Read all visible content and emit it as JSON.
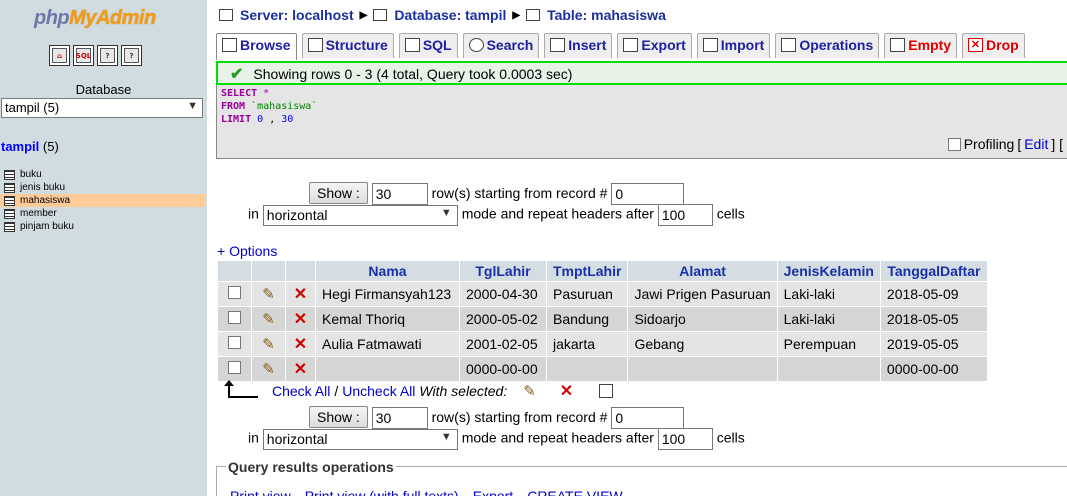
{
  "sidebar": {
    "logo_part1": "php",
    "logo_part2": "MyAdmin",
    "quick_icons": [
      "home-icon",
      "sql-query-icon",
      "docs-icon",
      "help-icon"
    ],
    "database_label": "Database",
    "database_select": "tampil (5)",
    "db_name": "tampil",
    "db_count": "(5)",
    "tables": [
      {
        "name": "buku",
        "active": false
      },
      {
        "name": "jenis buku",
        "active": false
      },
      {
        "name": "mahasiswa",
        "active": true
      },
      {
        "name": "member",
        "active": false
      },
      {
        "name": "pinjam buku",
        "active": false
      }
    ]
  },
  "breadcrumb": {
    "server": "Server: localhost",
    "database": "Database: tampil",
    "table": "Table: mahasiswa"
  },
  "tabs": [
    {
      "label": "Browse",
      "icon": "browse-icon",
      "active": true,
      "danger": false
    },
    {
      "label": "Structure",
      "icon": "structure-icon",
      "active": false,
      "danger": false
    },
    {
      "label": "SQL",
      "icon": "sql-icon",
      "active": false,
      "danger": false
    },
    {
      "label": "Search",
      "icon": "search-icon",
      "active": false,
      "danger": false
    },
    {
      "label": "Insert",
      "icon": "insert-icon",
      "active": false,
      "danger": false
    },
    {
      "label": "Export",
      "icon": "export-icon",
      "active": false,
      "danger": false
    },
    {
      "label": "Import",
      "icon": "import-icon",
      "active": false,
      "danger": false
    },
    {
      "label": "Operations",
      "icon": "operations-icon",
      "active": false,
      "danger": false
    },
    {
      "label": "Empty",
      "icon": "empty-icon",
      "active": false,
      "danger": true
    },
    {
      "label": "Drop",
      "icon": "drop-icon",
      "active": false,
      "danger": true
    }
  ],
  "message": "Showing rows 0 - 3 (4 total, Query took 0.0003 sec)",
  "sql": {
    "line1_kw": "SELECT",
    "line1_rest": "*",
    "line2_kw": "FROM",
    "line2_table": "`mahasiswa`",
    "line3_kw": "LIMIT",
    "line3_a": "0",
    "line3_sep": ",",
    "line3_b": "30"
  },
  "profiling": {
    "label": "Profiling",
    "edit": "Edit",
    "bracket_open": "[",
    "bracket_close": "] ["
  },
  "nav": {
    "show_label": "Show :",
    "rows_value": "30",
    "starting_text": "row(s) starting from record #",
    "start_value": "0",
    "in_text": "in",
    "mode_value": "horizontal",
    "mode_text": "mode and repeat headers after",
    "repeat_value": "100",
    "cells_text": "cells"
  },
  "options_link": "+ Options",
  "table": {
    "columns": [
      "Nama",
      "TglLahir",
      "TmptLahir",
      "Alamat",
      "JenisKelamin",
      "TanggalDaftar"
    ],
    "rows": [
      [
        "Hegi Firmansyah123",
        "2000-04-30",
        "Pasuruan",
        "Jawi Prigen Pasuruan",
        "Laki-laki",
        "2018-05-09"
      ],
      [
        "Kemal Thoriq",
        "2000-05-02",
        "Bandung",
        "Sidoarjo",
        "Laki-laki",
        "2018-05-05"
      ],
      [
        "Aulia Fatmawati",
        "2001-02-05",
        "jakarta",
        "Gebang",
        "Perempuan",
        "2019-05-05"
      ],
      [
        "",
        "0000-00-00",
        "",
        "",
        "",
        "0000-00-00"
      ]
    ]
  },
  "bulk": {
    "check_all": "Check All",
    "separator": "/",
    "uncheck_all": "Uncheck All",
    "with_selected": "With selected:"
  },
  "query_results": {
    "legend": "Query results operations",
    "links": [
      "Print view",
      "Print view (with full texts)",
      "Export",
      "CREATE VIEW"
    ]
  }
}
